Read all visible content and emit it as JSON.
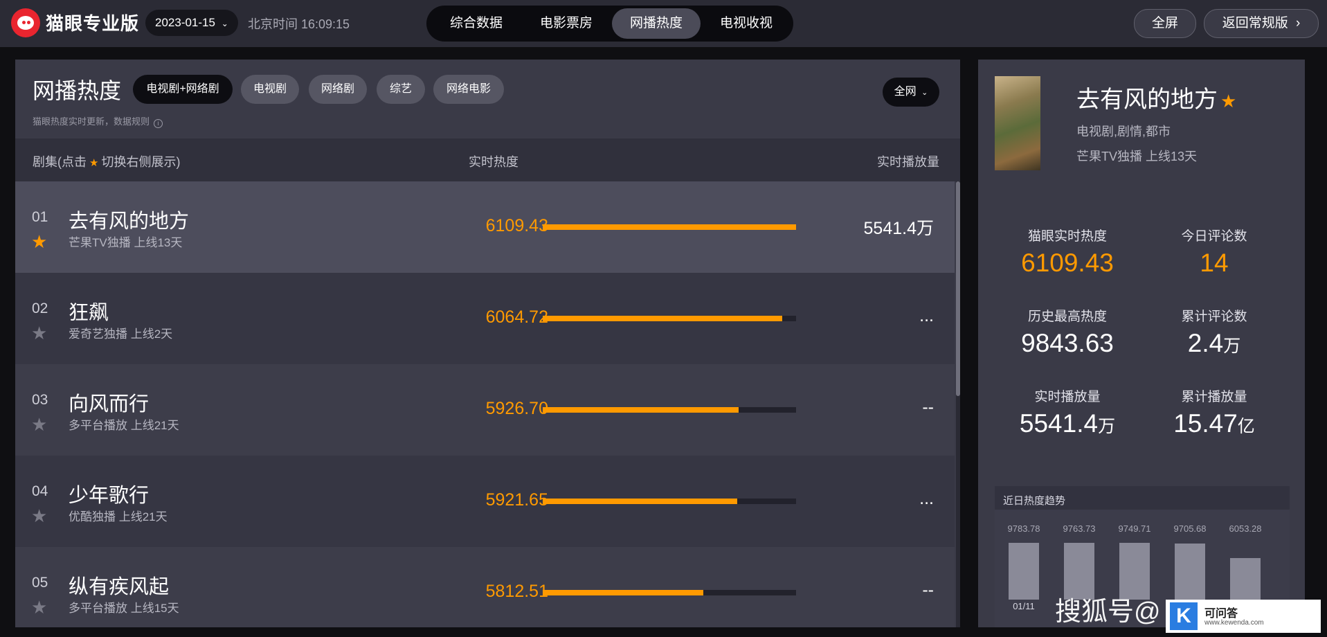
{
  "app": {
    "brand": "猫眼专业版",
    "date": "2023-01-15",
    "clock": "北京时间 16:09:15"
  },
  "nav": {
    "tabs": [
      {
        "label": "综合数据"
      },
      {
        "label": "电影票房"
      },
      {
        "label": "网播热度",
        "active": true
      },
      {
        "label": "电视收视"
      }
    ],
    "fullscreen": "全屏",
    "back": "返回常规版",
    "back_chevron": "›"
  },
  "list": {
    "title": "网播热度",
    "filters": [
      {
        "label": "电视剧+网络剧",
        "active": true
      },
      {
        "label": "电视剧"
      },
      {
        "label": "网络剧"
      },
      {
        "label": "综艺"
      },
      {
        "label": "网络电影"
      }
    ],
    "scope": "全网",
    "note": "猫眼热度实时更新，数据规则",
    "headers": {
      "name_prefix": "剧集(点击",
      "name_suffix": "切换右侧展示)",
      "heat": "实时热度",
      "views": "实时播放量"
    },
    "rows": [
      {
        "rank": "01",
        "name": "去有风的地方",
        "meta": "芒果TV独播  上线13天",
        "heat": "6109.43",
        "heat_value": 6109.43,
        "views": "5541.4万",
        "starred": true
      },
      {
        "rank": "02",
        "name": "狂飙",
        "meta": "爱奇艺独播  上线2天",
        "heat": "6064.72",
        "heat_value": 6064.72,
        "views": "...",
        "starred": false
      },
      {
        "rank": "03",
        "name": "向风而行",
        "meta": "多平台播放  上线21天",
        "heat": "5926.70",
        "heat_value": 5926.7,
        "views": "--",
        "starred": false
      },
      {
        "rank": "04",
        "name": "少年歌行",
        "meta": "优酷独播  上线21天",
        "heat": "5921.65",
        "heat_value": 5921.65,
        "views": "...",
        "starred": false
      },
      {
        "rank": "05",
        "name": "纵有疾风起",
        "meta": "多平台播放  上线15天",
        "heat": "5812.51",
        "heat_value": 5812.51,
        "views": "--",
        "starred": false
      }
    ]
  },
  "detail": {
    "title": "去有风的地方",
    "genres": "电视剧,剧情,都市",
    "platform": "芒果TV独播  上线13天",
    "stats": {
      "realtime_heat_label": "猫眼实时热度",
      "realtime_heat": "6109.43",
      "today_comments_label": "今日评论数",
      "today_comments": "14",
      "max_heat_label": "历史最高热度",
      "max_heat": "9843.63",
      "total_comments_label": "累计评论数",
      "total_comments": "2.4",
      "total_comments_unit": "万",
      "realtime_views_label": "实时播放量",
      "realtime_views": "5541.4",
      "realtime_views_unit": "万",
      "total_views_label": "累计播放量",
      "total_views": "15.47",
      "total_views_unit": "亿"
    },
    "trend": {
      "title": "近日热度趋势",
      "values": [
        "9783.78",
        "9763.73",
        "9749.71",
        "9705.68",
        "6053.28"
      ],
      "numbers": [
        9783.78,
        9763.73,
        9749.71,
        9705.68,
        6053.28
      ],
      "first_date": "01/11"
    }
  },
  "watermark": {
    "text": "搜狐号@",
    "badge_letter": "K",
    "badge_title": "可问答",
    "badge_url": "www.kewenda.com"
  },
  "colors": {
    "accent": "#ff9a00",
    "bg": "#3a3a47",
    "brand_red": "#e9252f"
  }
}
